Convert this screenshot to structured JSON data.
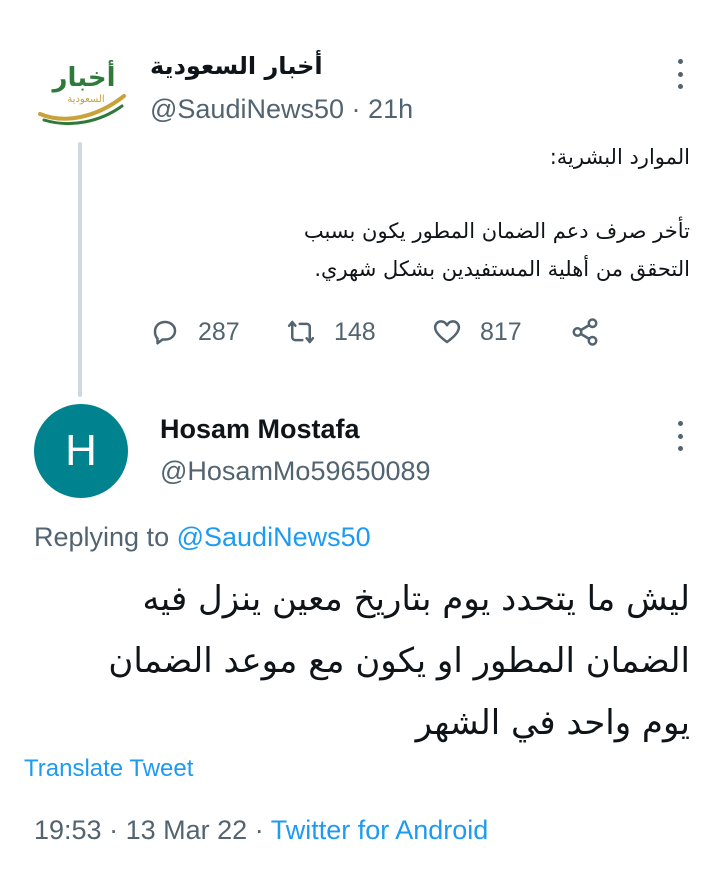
{
  "parent_tweet": {
    "avatar_logo_text": "أخبار",
    "avatar_logo_sub": "السعودية",
    "display_name": "أخبار السعودية",
    "handle": "@SaudiNews50",
    "separator": "·",
    "time": "21h",
    "text_line1": "الموارد البشرية:",
    "text_line2": "تأخر صرف دعم الضمان المطور يكون بسبب",
    "text_line3": "التحقق من أهلية المستفيدين بشكل شهري.",
    "replies": "287",
    "retweets": "148",
    "likes": "817",
    "icons": {
      "reply": "reply-icon",
      "retweet": "retweet-icon",
      "like": "heart-icon",
      "share": "share-icon",
      "more": "more-vertical-icon"
    }
  },
  "reply_tweet": {
    "avatar_letter": "H",
    "avatar_color": "#00838f",
    "display_name": "Hosam Mostafa",
    "handle": "@HosamMo59650089",
    "replying_prefix": "Replying to",
    "replying_to": "@SaudiNews50",
    "text_line1": "ليش ما يتحدد يوم بتاريخ معين ينزل فيه",
    "text_line2": "الضمان المطور او يكون مع موعد الضمان",
    "text_line3": "يوم واحد في الشهر",
    "translate_label": "Translate Tweet",
    "time": "19:53",
    "date": "13 Mar 22",
    "source": "Twitter for Android",
    "separator": "·"
  },
  "colors": {
    "accent": "#1d9bf0",
    "secondary_text": "#536471",
    "thread_line": "#cfd9de",
    "logo_gold": "#c9a23a",
    "logo_green": "#2f7a3a"
  }
}
